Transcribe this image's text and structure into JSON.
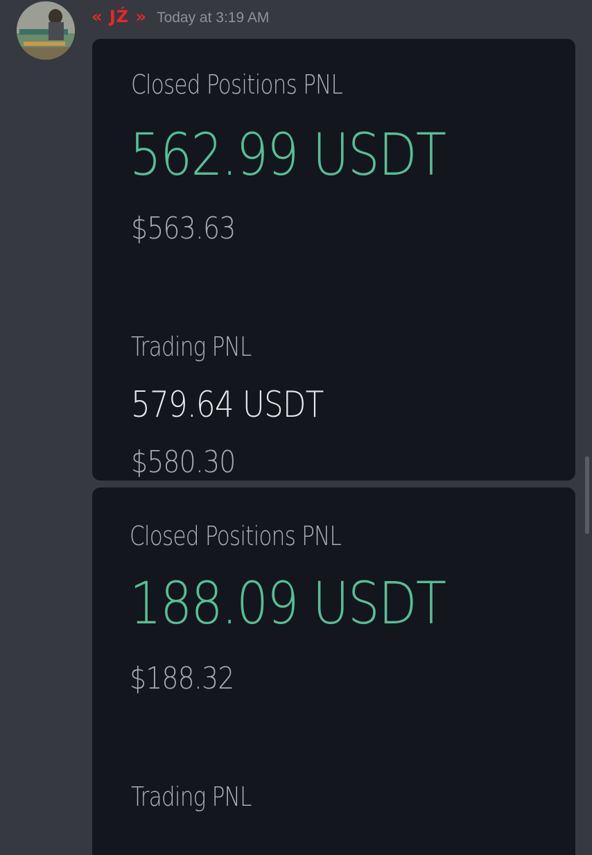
{
  "message": {
    "username": "« JŹ »",
    "timestamp": "Today at 3:19 AM"
  },
  "attachments": [
    {
      "closed_label": "Closed Positions PNL",
      "closed_value": "562.99 USDT",
      "closed_usd": "$563.63",
      "trading_label": "Trading PNL",
      "trading_value": "579.64 USDT",
      "trading_usd": "$580.30"
    },
    {
      "closed_label": "Closed Positions PNL",
      "closed_value": "188.09 USDT",
      "closed_usd": "$188.32",
      "trading_label": "Trading PNL"
    }
  ],
  "colors": {
    "background": "#36393f",
    "username": "#e8262a",
    "positive": "#55bf95",
    "card": "#13161c"
  }
}
